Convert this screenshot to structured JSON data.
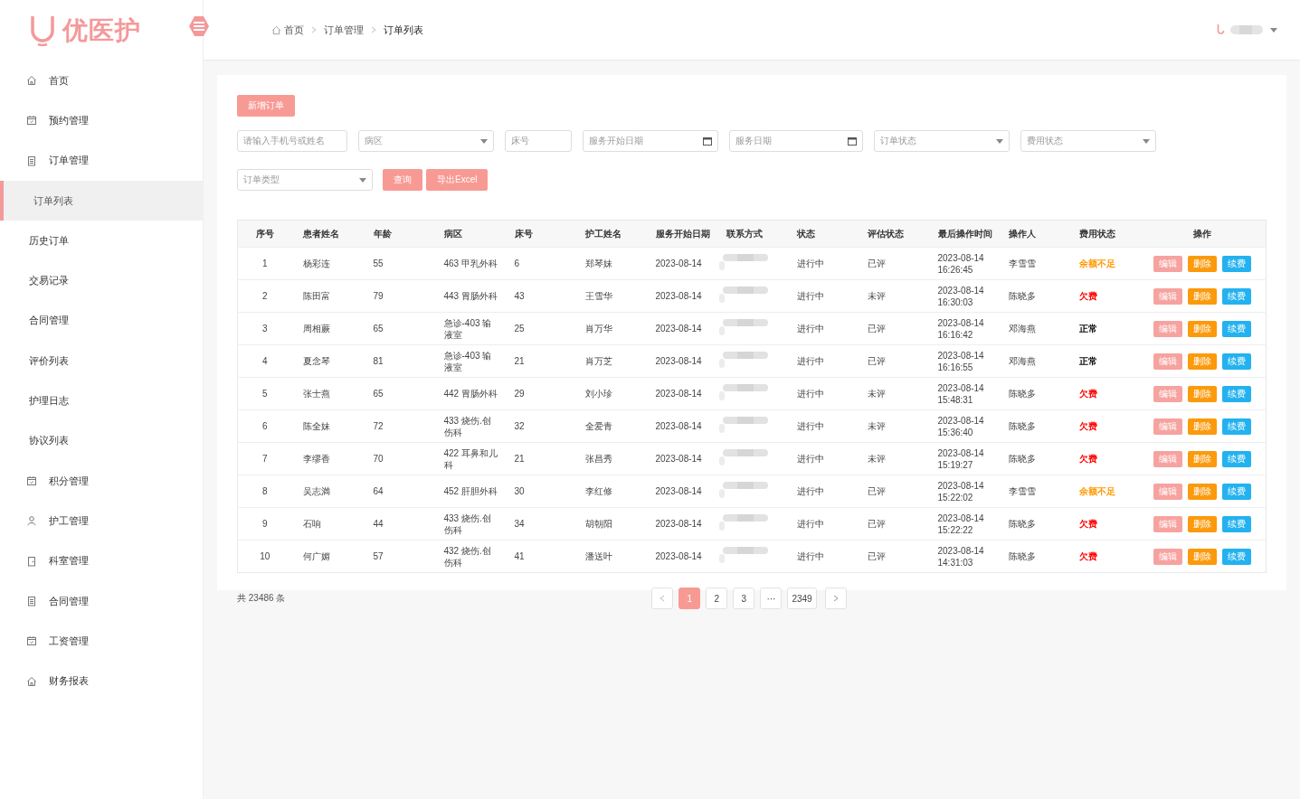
{
  "logo": {
    "text": "优医护"
  },
  "breadcrumb": [
    {
      "label": "首页",
      "kind": "home"
    },
    {
      "label": "订单管理",
      "kind": "link"
    },
    {
      "label": "订单列表",
      "kind": "current"
    }
  ],
  "sidebar": {
    "items": [
      {
        "label": "首页",
        "kind": "home",
        "selected": false
      },
      {
        "label": "预约管理",
        "kind": "calendar",
        "selected": false
      },
      {
        "label": "订单管理",
        "kind": "document",
        "selected": false
      },
      {
        "label": "订单列表",
        "kind": "sub",
        "selected": true
      },
      {
        "label": "历史订单",
        "kind": "sub",
        "selected": false
      },
      {
        "label": "交易记录",
        "kind": "sub",
        "selected": false
      },
      {
        "label": "合同管理",
        "kind": "sub",
        "selected": false
      },
      {
        "label": "评价列表",
        "kind": "sub",
        "selected": false
      },
      {
        "label": "护理日志",
        "kind": "sub",
        "selected": false
      },
      {
        "label": "协议列表",
        "kind": "sub",
        "selected": false
      },
      {
        "label": "积分管理",
        "kind": "calendar",
        "selected": false
      },
      {
        "label": "护工管理",
        "kind": "person",
        "selected": false
      },
      {
        "label": "科室管理",
        "kind": "door",
        "selected": false
      },
      {
        "label": "合同管理",
        "kind": "document",
        "selected": false
      },
      {
        "label": "工资管理",
        "kind": "calendar",
        "selected": false
      },
      {
        "label": "财务报表",
        "kind": "home",
        "selected": false
      }
    ]
  },
  "add_button": "新增订单",
  "filters": [
    {
      "kind": "input",
      "placeholder": "请输入手机号或姓名"
    },
    {
      "kind": "select",
      "placeholder": "病区"
    },
    {
      "kind": "input",
      "placeholder": "床号"
    },
    {
      "kind": "date",
      "placeholder": "服务开始日期"
    },
    {
      "kind": "date",
      "placeholder": "服务日期"
    },
    {
      "kind": "select",
      "placeholder": "订单状态"
    },
    {
      "kind": "select",
      "placeholder": "费用状态"
    },
    {
      "kind": "select",
      "placeholder": "订单类型"
    }
  ],
  "search_button": "查询",
  "export_button": "导出Excel",
  "table": {
    "columns": [
      "序号",
      "患者姓名",
      "年龄",
      "病区",
      "床号",
      "护工姓名",
      "服务开始日期",
      "联系方式",
      "状态",
      "评估状态",
      "最后操作时间",
      "操作人",
      "费用状态",
      "操作"
    ],
    "rows": [
      {
        "no": "1",
        "patient": "杨彩连",
        "age": "55",
        "ward": "463 甲乳外科",
        "bed": "6",
        "nurse": "郑琴妹",
        "start": "2023-08-14",
        "status": "进行中",
        "eval": "已评",
        "time": "2023-08-14 16:26:45",
        "operator": "李雪雪",
        "fee": {
          "text": "余额不足",
          "color": "#ff9900"
        },
        "actions": [
          {
            "label": "编辑",
            "kind": "edit"
          },
          {
            "label": "删除",
            "kind": "delete"
          },
          {
            "label": "续费",
            "kind": "renew"
          }
        ]
      },
      {
        "no": "2",
        "patient": "陈田富",
        "age": "79",
        "ward": "443 胃肠外科",
        "bed": "43",
        "nurse": "王雪华",
        "start": "2023-08-14",
        "status": "进行中",
        "eval": "未评",
        "time": "2023-08-14 16:30:03",
        "operator": "陈晓多",
        "fee": {
          "text": "欠费",
          "color": "#ff0000"
        },
        "actions": [
          {
            "label": "编辑",
            "kind": "edit"
          },
          {
            "label": "删除",
            "kind": "delete"
          },
          {
            "label": "续费",
            "kind": "renew"
          }
        ]
      },
      {
        "no": "3",
        "patient": "周相蕨",
        "age": "65",
        "ward": "急诊-403 输液室",
        "bed": "25",
        "nurse": "肖万华",
        "start": "2023-08-14",
        "status": "进行中",
        "eval": "已评",
        "time": "2023-08-14 16:16:42",
        "operator": "邓海燕",
        "fee": {
          "text": "正常",
          "color": "#000000"
        },
        "actions": [
          {
            "label": "编辑",
            "kind": "edit"
          },
          {
            "label": "删除",
            "kind": "delete"
          },
          {
            "label": "续费",
            "kind": "renew"
          }
        ]
      },
      {
        "no": "4",
        "patient": "夏念琴",
        "age": "81",
        "ward": "急诊-403 输液室",
        "bed": "21",
        "nurse": "肖万芝",
        "start": "2023-08-14",
        "status": "进行中",
        "eval": "已评",
        "time": "2023-08-14 16:16:55",
        "operator": "邓海燕",
        "fee": {
          "text": "正常",
          "color": "#000000"
        },
        "actions": [
          {
            "label": "编辑",
            "kind": "edit"
          },
          {
            "label": "删除",
            "kind": "delete"
          },
          {
            "label": "续费",
            "kind": "renew"
          }
        ]
      },
      {
        "no": "5",
        "patient": "张士燕",
        "age": "65",
        "ward": "442 胃肠外科",
        "bed": "29",
        "nurse": "刘小珍",
        "start": "2023-08-14",
        "status": "进行中",
        "eval": "未评",
        "time": "2023-08-14 15:48:31",
        "operator": "陈晓多",
        "fee": {
          "text": "欠费",
          "color": "#ff0000"
        },
        "actions": [
          {
            "label": "编辑",
            "kind": "edit"
          },
          {
            "label": "删除",
            "kind": "delete"
          },
          {
            "label": "续费",
            "kind": "renew"
          }
        ]
      },
      {
        "no": "6",
        "patient": "陈全妹",
        "age": "72",
        "ward": "433 烧伤.创伤科",
        "bed": "32",
        "nurse": "全爱青",
        "start": "2023-08-14",
        "status": "进行中",
        "eval": "未评",
        "time": "2023-08-14 15:36:40",
        "operator": "陈晓多",
        "fee": {
          "text": "欠费",
          "color": "#ff0000"
        },
        "actions": [
          {
            "label": "编辑",
            "kind": "edit"
          },
          {
            "label": "删除",
            "kind": "delete"
          },
          {
            "label": "续费",
            "kind": "renew"
          }
        ]
      },
      {
        "no": "7",
        "patient": "李缪香",
        "age": "70",
        "ward": "422 耳鼻和儿科",
        "bed": "21",
        "nurse": "张昌秀",
        "start": "2023-08-14",
        "status": "进行中",
        "eval": "未评",
        "time": "2023-08-14 15:19:27",
        "operator": "陈晓多",
        "fee": {
          "text": "欠费",
          "color": "#ff0000"
        },
        "actions": [
          {
            "label": "编辑",
            "kind": "edit"
          },
          {
            "label": "删除",
            "kind": "delete"
          },
          {
            "label": "续费",
            "kind": "renew"
          }
        ]
      },
      {
        "no": "8",
        "patient": "吴志満",
        "age": "64",
        "ward": "452 肝胆外科",
        "bed": "30",
        "nurse": "李红修",
        "start": "2023-08-14",
        "status": "进行中",
        "eval": "已评",
        "time": "2023-08-14 15:22:02",
        "operator": "李雪雪",
        "fee": {
          "text": "余额不足",
          "color": "#ff9900"
        },
        "actions": [
          {
            "label": "编辑",
            "kind": "edit"
          },
          {
            "label": "删除",
            "kind": "delete"
          },
          {
            "label": "续费",
            "kind": "renew"
          }
        ]
      },
      {
        "no": "9",
        "patient": "石响",
        "age": "44",
        "ward": "433 烧伤.创伤科",
        "bed": "34",
        "nurse": "胡朝阳",
        "start": "2023-08-14",
        "status": "进行中",
        "eval": "已评",
        "time": "2023-08-14 15:22:22",
        "operator": "陈晓多",
        "fee": {
          "text": "欠费",
          "color": "#ff0000"
        },
        "actions": [
          {
            "label": "编辑",
            "kind": "edit"
          },
          {
            "label": "删除",
            "kind": "delete"
          },
          {
            "label": "续费",
            "kind": "renew"
          }
        ]
      },
      {
        "no": "10",
        "patient": "何广媚",
        "age": "57",
        "ward": "432 烧伤.创伤科",
        "bed": "41",
        "nurse": "潘送叶",
        "start": "2023-08-14",
        "status": "进行中",
        "eval": "已评",
        "time": "2023-08-14 14:31:03",
        "operator": "陈晓多",
        "fee": {
          "text": "欠费",
          "color": "#ff0000"
        },
        "actions": [
          {
            "label": "编辑",
            "kind": "edit"
          },
          {
            "label": "删除",
            "kind": "delete"
          },
          {
            "label": "续费",
            "kind": "renew"
          }
        ]
      }
    ]
  },
  "total": "共 23486 条",
  "pagination": [
    {
      "label": "1",
      "selected": true
    },
    {
      "label": "2",
      "selected": false
    },
    {
      "label": "3",
      "selected": false
    },
    {
      "label": "···",
      "selected": false
    },
    {
      "label": "2349",
      "selected": false
    }
  ]
}
